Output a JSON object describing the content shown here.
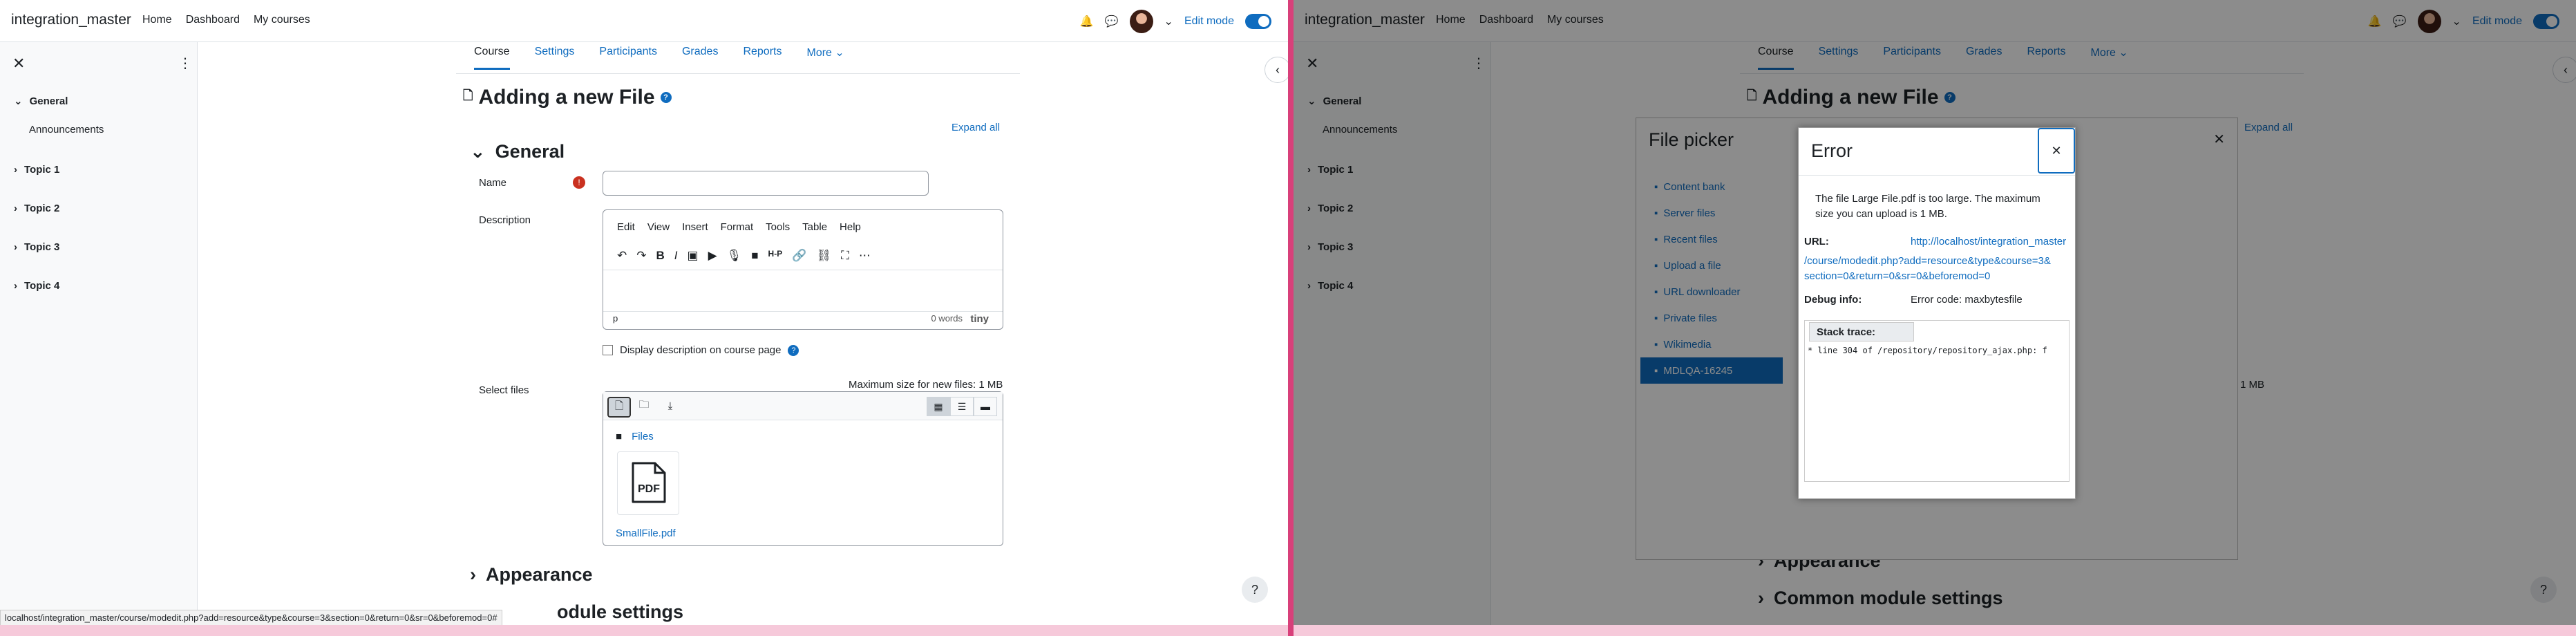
{
  "navbar": {
    "site_name": "integration_master",
    "links": [
      "Home",
      "Dashboard",
      "My courses"
    ],
    "edit_mode": "Edit mode"
  },
  "course_index": {
    "sections": [
      {
        "title": "General",
        "items": [
          "Announcements"
        ]
      },
      {
        "title": "Topic 1",
        "items": []
      },
      {
        "title": "Topic 2",
        "items": []
      },
      {
        "title": "Topic 3",
        "items": []
      },
      {
        "title": "Topic 4",
        "items": []
      }
    ]
  },
  "course_tabs": [
    "Course",
    "Settings",
    "Participants",
    "Grades",
    "Reports",
    "More"
  ],
  "page_title": "Adding a new File",
  "expand_all": "Expand all",
  "form": {
    "general_heading": "General",
    "name_label": "Name",
    "description_label": "Description",
    "editor_menu": [
      "Edit",
      "View",
      "Insert",
      "Format",
      "Tools",
      "Table",
      "Help"
    ],
    "editor_status_tag": "p",
    "editor_wordcount": "0 words",
    "editor_brand": "tiny",
    "display_description": "Display description on course page",
    "select_files_label": "Select files",
    "max_size": "Maximum size for new files: 1 MB",
    "path_root": "Files",
    "file_name": "SmallFile.pdf",
    "appearance_heading": "Appearance",
    "common_settings_heading": "Common module settings",
    "common_settings_partial": "odule settings"
  },
  "status_url": "localhost/integration_master/course/modedit.php?add=resource&type&course=3&section=0&return=0&sr=0&beforemod=0#",
  "file_picker": {
    "title": "File picker",
    "repositories": [
      "Content bank",
      "Server files",
      "Recent files",
      "Upload a file",
      "URL downloader",
      "Private files",
      "Wikimedia",
      "MDLQA-16245"
    ],
    "active_repository": "MDLQA-16245"
  },
  "error_dialog": {
    "title": "Error",
    "message": "The file Large File.pdf is too large. The maximum size you can upload is 1 MB.",
    "url_label": "URL:",
    "url_value_line1": "http://localhost/integration_master",
    "url_value_line2": "/course/modedit.php?add=resource&type&course=3&",
    "url_value_line3": "section=0&return=0&sr=0&beforemod=0",
    "debug_label": "Debug info:",
    "debug_value": "Error code: maxbytesfile",
    "stack_label": "Stack trace:",
    "stack_line": "* line 304 of /repository/repository_ajax.php: f"
  },
  "colors": {
    "primary": "#0f6cbf",
    "divider": "#d8407a",
    "danger": "#ca3120"
  }
}
